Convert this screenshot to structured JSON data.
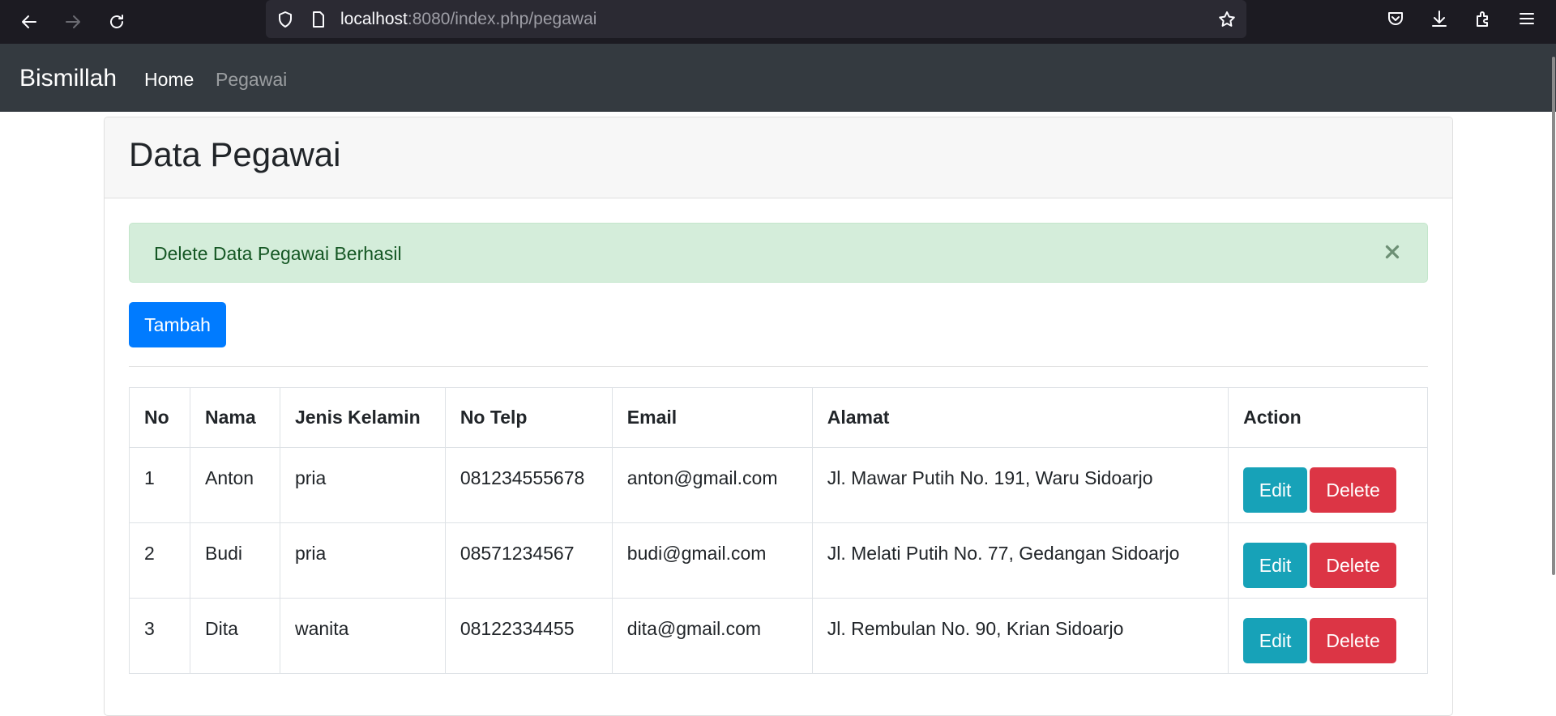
{
  "browser": {
    "url_host": "localhost",
    "url_rest": ":8080/index.php/pegawai"
  },
  "navbar": {
    "brand": "Bismillah",
    "links": [
      "Home",
      "Pegawai"
    ]
  },
  "page": {
    "title": "Data Pegawai",
    "alert_message": "Delete Data Pegawai Berhasil",
    "add_button": "Tambah"
  },
  "table": {
    "headers": [
      "No",
      "Nama",
      "Jenis Kelamin",
      "No Telp",
      "Email",
      "Alamat",
      "Action"
    ],
    "rows": [
      [
        "1",
        "Anton",
        "pria",
        "081234555678",
        "anton@gmail.com",
        "Jl. Mawar Putih No. 191, Waru Sidoarjo"
      ],
      [
        "2",
        "Budi",
        "pria",
        "08571234567",
        "budi@gmail.com",
        "Jl. Melati Putih No. 77, Gedangan Sidoarjo"
      ],
      [
        "3",
        "Dita",
        "wanita",
        "08122334455",
        "dita@gmail.com",
        "Jl. Rembulan No. 90, Krian Sidoarjo"
      ]
    ],
    "edit_label": "Edit",
    "delete_label": "Delete"
  },
  "colors": {
    "navbar_bg": "#343a40",
    "primary": "#007bff",
    "info": "#17a2b8",
    "danger": "#dc3545",
    "success_bg": "#d4edda",
    "success_text": "#155724"
  },
  "icons": [
    "back-arrow-icon",
    "forward-arrow-icon",
    "reload-icon",
    "shield-icon",
    "page-icon",
    "star-icon",
    "pocket-icon",
    "download-icon",
    "extensions-icon",
    "menu-icon",
    "close-icon"
  ]
}
